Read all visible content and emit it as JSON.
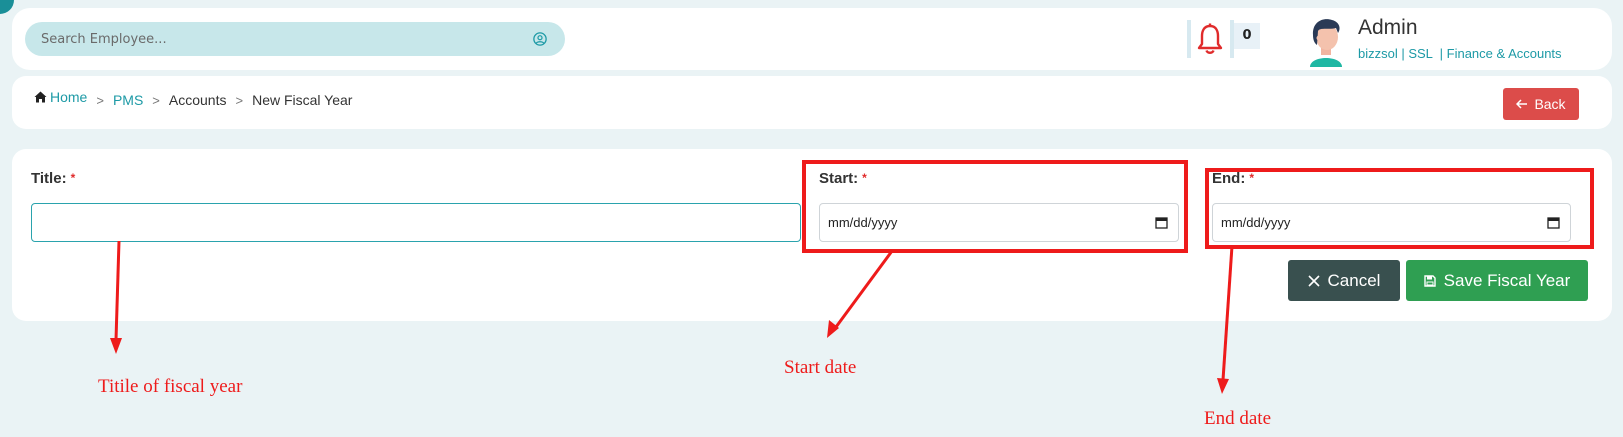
{
  "header": {
    "search": {
      "placeholder": "Search Employee..."
    },
    "notifications": {
      "count": "0"
    },
    "user": {
      "name": "Admin",
      "org": "bizzsol | SSL  | Finance & Accounts"
    }
  },
  "breadcrumb": {
    "items": [
      "Home",
      "PMS",
      "Accounts",
      "New Fiscal Year"
    ],
    "back_label": "Back"
  },
  "form": {
    "title": {
      "label": "Title:",
      "required": "*",
      "value": ""
    },
    "start": {
      "label": "Start:",
      "required": "*",
      "value": "mm/dd/yyyy"
    },
    "end": {
      "label": "End:",
      "required": "*",
      "value": "mm/dd/yyyy"
    },
    "cancel_label": "Cancel",
    "save_label": "Save Fiscal Year"
  },
  "annotations": {
    "title_note": "Titile of fiscal year",
    "start_note": "Start date",
    "end_note": "End date"
  },
  "colors": {
    "accent": "#1d9aa6",
    "danger": "#dc4c4a",
    "success": "#2f9f52",
    "dark": "#39504f",
    "annotation": "#ee1b1b"
  }
}
